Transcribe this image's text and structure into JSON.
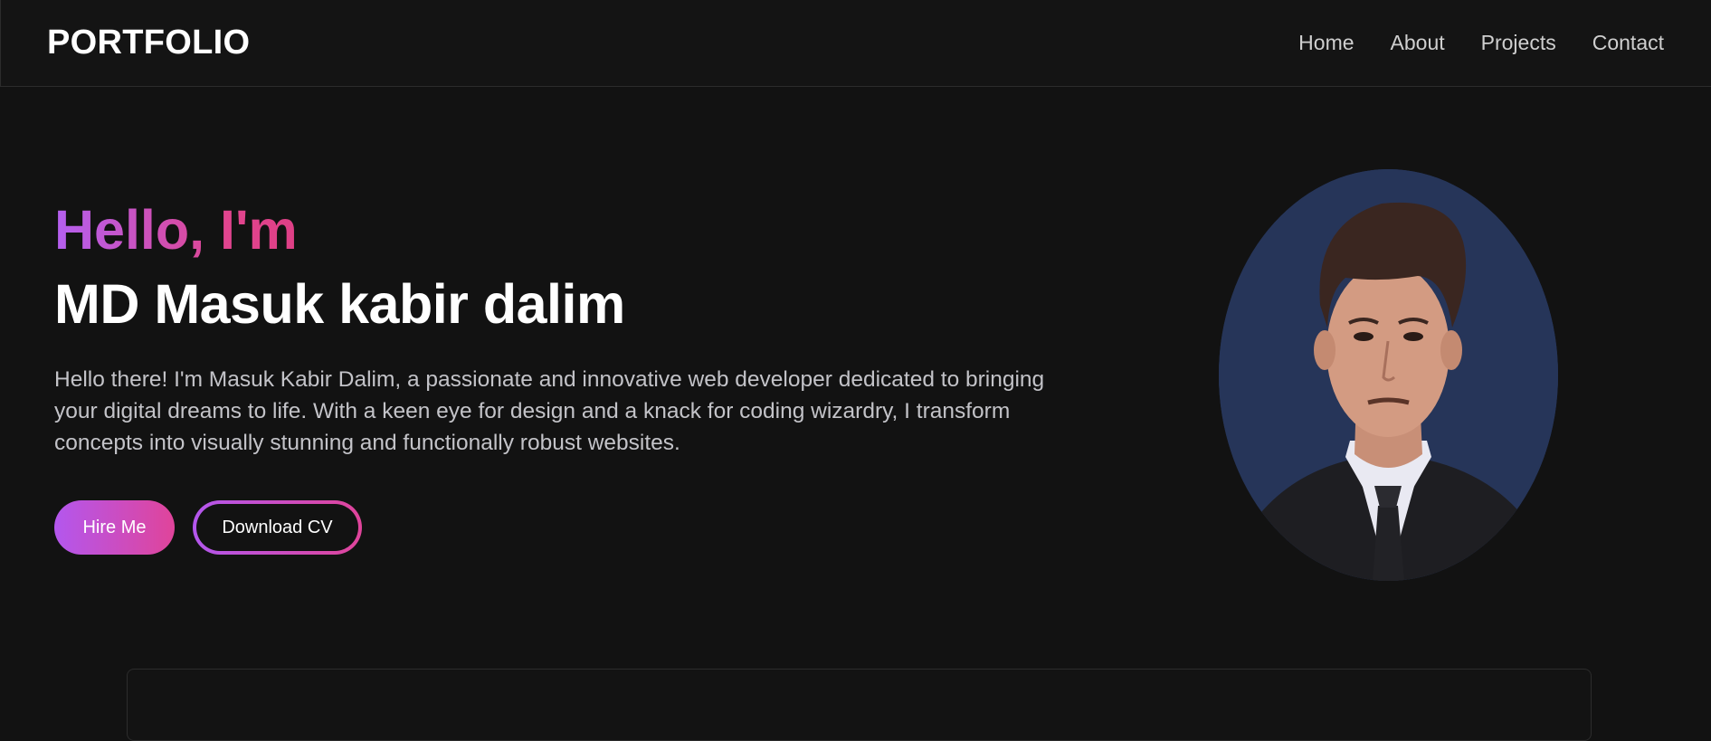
{
  "navbar": {
    "brand": "PORTFOLIO",
    "links": [
      {
        "label": "Home"
      },
      {
        "label": "About"
      },
      {
        "label": "Projects"
      },
      {
        "label": "Contact"
      }
    ]
  },
  "hero": {
    "greeting": "Hello, I'm",
    "name": "MD Masuk kabir dalim",
    "bio": "Hello there! I'm Masuk Kabir Dalim, a passionate and innovative web developer dedicated to bringing your digital dreams to life. With a keen eye for design and a knack for coding wizardry, I transform concepts into visually stunning and functionally robust websites.",
    "hire_label": "Hire Me",
    "cv_label": "Download CV",
    "avatar_icon": "profile-photo"
  },
  "colors": {
    "background": "#121212",
    "accent_start": "#b357ee",
    "accent_end": "#e0449a",
    "avatar_bg": "#263559"
  }
}
